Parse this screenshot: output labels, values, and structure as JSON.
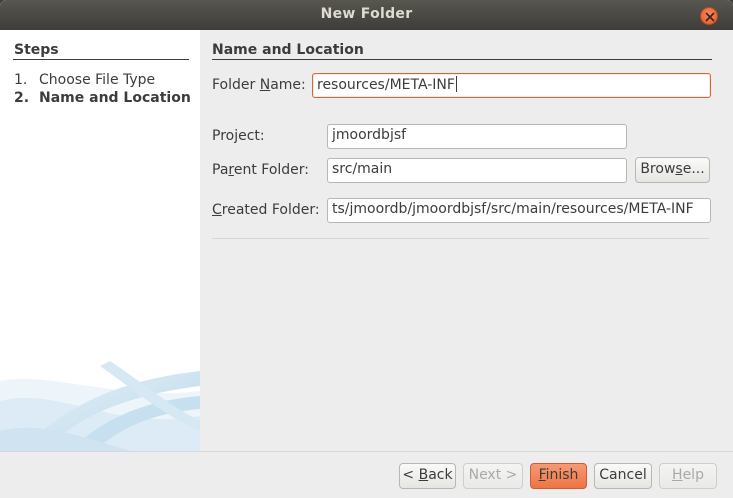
{
  "window": {
    "title": "New Folder"
  },
  "steps": {
    "heading": "Steps",
    "items": [
      {
        "num": "1.",
        "label": "Choose File Type"
      },
      {
        "num": "2.",
        "label": "Name and Location"
      }
    ]
  },
  "section": {
    "heading": "Name and Location"
  },
  "form": {
    "folder_name": {
      "label_pre": "Folder ",
      "label_mn": "N",
      "label_post": "ame:",
      "value": "resources/META-INF"
    },
    "project": {
      "label": "Project:",
      "value": "jmoordbjsf"
    },
    "parent_folder": {
      "label_pre": "Pa",
      "label_mn": "r",
      "label_post": "ent Folder:",
      "value": "src/main"
    },
    "created_folder": {
      "label_pre": "",
      "label_mn": "C",
      "label_post": "reated Folder:",
      "value": "ts/jmoordb/jmoordbjsf/src/main/resources/META-INF"
    },
    "browse_button": {
      "pre": "Brow",
      "mn": "s",
      "post": "e..."
    }
  },
  "footer": {
    "back": {
      "pre": "< ",
      "mn": "B",
      "post": "ack"
    },
    "next": "Next >",
    "finish": {
      "mn": "F",
      "post": "inish"
    },
    "cancel": "Cancel",
    "help": {
      "mn": "H",
      "post": "elp"
    }
  },
  "colors": {
    "accent": "#ee7444",
    "titlebar": "#3e3d39",
    "focus_border": "#d9633a"
  }
}
